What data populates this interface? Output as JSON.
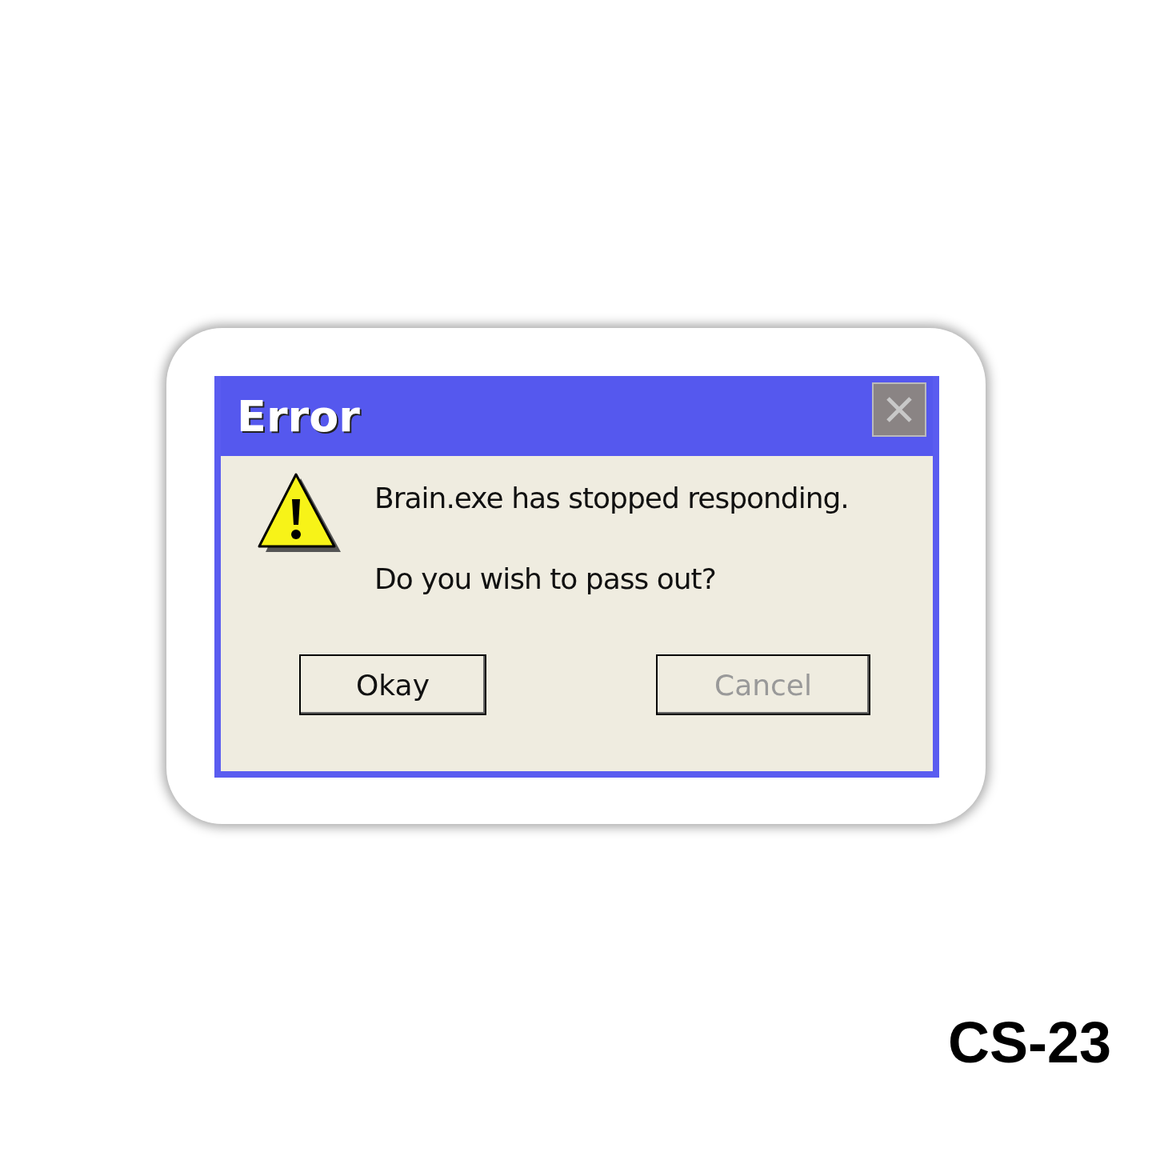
{
  "window": {
    "title": "Error"
  },
  "message": [
    "Brain.exe has stopped responding.",
    "Do you wish to pass out?"
  ],
  "buttons": [
    {
      "label": "Okay",
      "disabled": false
    },
    {
      "label": "Cancel",
      "disabled": true
    }
  ],
  "product_code": "CS-23"
}
